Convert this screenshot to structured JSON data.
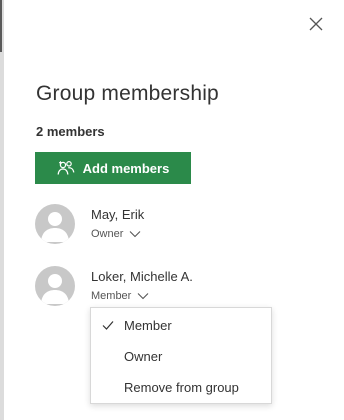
{
  "panel": {
    "title": "Group membership",
    "member_count": "2 members",
    "add_button_label": "Add members",
    "close_icon": "close-icon"
  },
  "members": [
    {
      "name": "May, Erik",
      "role": "Owner",
      "avatar_icon": "person-icon"
    },
    {
      "name": "Loker, Michelle A.",
      "role": "Member",
      "avatar_icon": "person-icon"
    }
  ],
  "role_menu": {
    "open_for_member": "Loker, Michelle A.",
    "items": [
      {
        "label": "Member",
        "selected": true
      },
      {
        "label": "Owner",
        "selected": false
      },
      {
        "label": "Remove from group",
        "selected": false
      }
    ]
  },
  "colors": {
    "accent": "#2b8a4a",
    "avatar_bg": "#c8c8c8",
    "avatar_fg": "#ffffff"
  }
}
